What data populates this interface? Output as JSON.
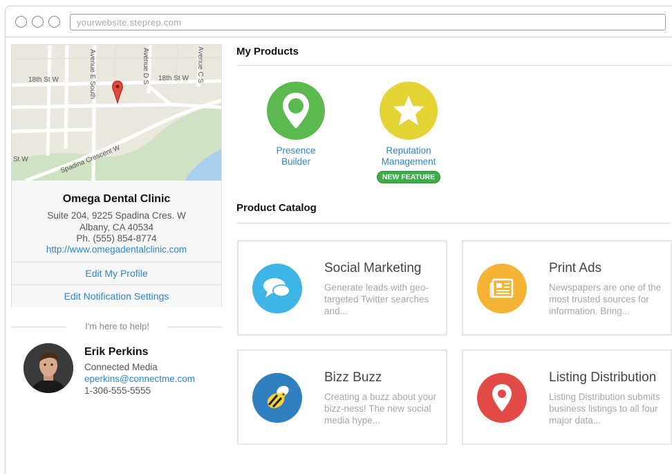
{
  "browser": {
    "url": "yourwebsite.steprep.com"
  },
  "map": {
    "street_labels": [
      "18th St W",
      "18th St W",
      "Avenue E South",
      "Avenue D S",
      "Avenue C S",
      "Spadina Crescent W",
      "St W"
    ]
  },
  "business": {
    "name": "Omega Dental Clinic",
    "address_line1": "Suite 204, 9225 Spadina Cres. W",
    "address_line2": "Albany, CA 40534",
    "phone": "Ph. (555) 854-8774",
    "website": "http://www.omegadentalclinic.com",
    "edit_profile": "Edit My Profile",
    "edit_notifications": "Edit Notification Settings"
  },
  "help": {
    "heading": "I'm here to help!",
    "name": "Erik Perkins",
    "company": "Connected Media",
    "email": "eperkins@connectme.com",
    "phone": "1-306-555-5555"
  },
  "my_products": {
    "title": "My Products",
    "items": [
      {
        "label_line1": "Presence",
        "label_line2": "Builder",
        "icon": "location-pin-icon",
        "color": "#5cb94f"
      },
      {
        "label_line1": "Reputation",
        "label_line2": "Management",
        "icon": "star-icon",
        "color": "#e3d335",
        "badge": "NEW FEATURE"
      }
    ]
  },
  "catalog": {
    "title": "Product Catalog",
    "items": [
      {
        "title": "Social Marketing",
        "desc": "Generate leads with geo-targeted Twitter searches and...",
        "icon": "speech-bubbles-icon",
        "color": "#3fb4e6"
      },
      {
        "title": "Print Ads",
        "desc": "Newspapers are one of the most trusted sources for information. Bring...",
        "icon": "newspaper-icon",
        "color": "#f5b335"
      },
      {
        "title": "Bizz Buzz",
        "desc": "Creating a buzz about your bizz-ness! The new social media hype...",
        "icon": "bee-icon",
        "color": "#2f7fc1"
      },
      {
        "title": "Listing Distribution",
        "desc": "Listing Distribution submits business listings to all four major data...",
        "icon": "location-pin-icon",
        "color": "#e24b45"
      }
    ]
  }
}
